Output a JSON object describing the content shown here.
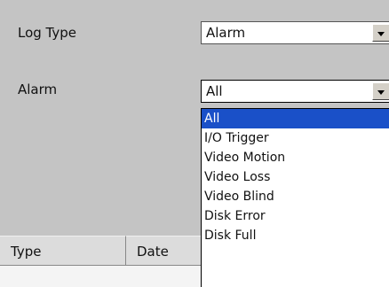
{
  "form": {
    "log_type_label": "Log Type",
    "log_type_value": "Alarm",
    "alarm_label": "Alarm",
    "alarm_value": "All"
  },
  "alarm_options": [
    "All",
    "I/O Trigger",
    "Video Motion",
    "Video Loss",
    "Video Blind",
    "Disk Error",
    "Disk Full"
  ],
  "selected_index": 0,
  "table": {
    "columns": [
      "Type",
      "Date"
    ]
  }
}
